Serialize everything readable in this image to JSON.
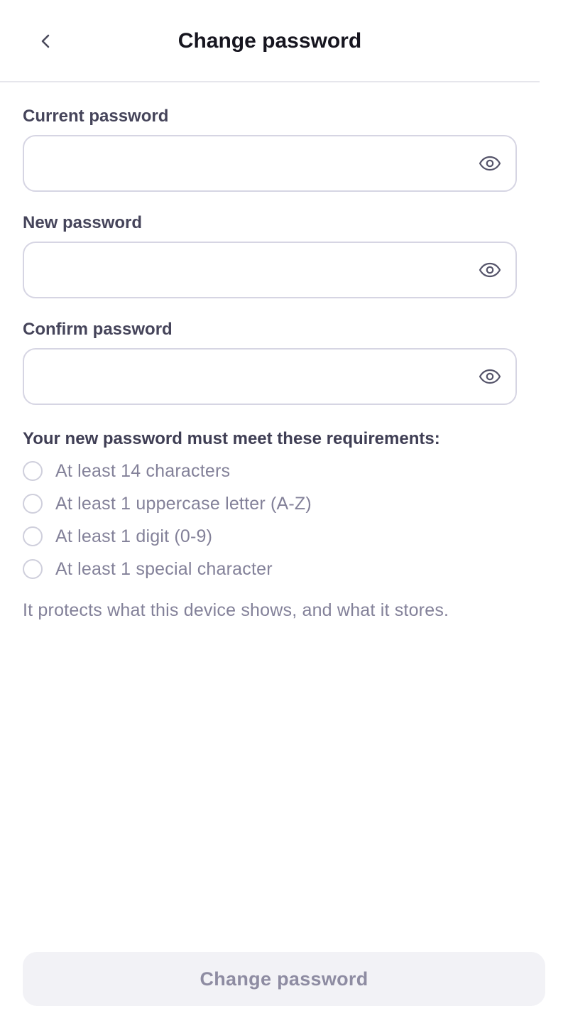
{
  "header": {
    "title": "Change password",
    "back_icon": "chevron-left-icon"
  },
  "fields": {
    "current": {
      "label": "Current password",
      "value": "",
      "icon": "eye-icon"
    },
    "new": {
      "label": "New password",
      "value": "",
      "icon": "eye-icon"
    },
    "confirm": {
      "label": "Confirm password",
      "value": "",
      "icon": "eye-icon"
    }
  },
  "requirements": {
    "heading": "Your new password must meet these requirements:",
    "items": [
      {
        "label": "At least 14 characters",
        "met": false
      },
      {
        "label": "At least 1 uppercase letter (A-Z)",
        "met": false
      },
      {
        "label": "At least 1 digit (0-9)",
        "met": false
      },
      {
        "label": "At least 1 special character",
        "met": false
      }
    ]
  },
  "note": "It protects what this device shows, and what it stores.",
  "submit": {
    "label": "Change password",
    "enabled": false
  },
  "colors": {
    "title": "#16151f",
    "label": "#45445a",
    "muted_text": "#838199",
    "input_border": "#d6d5e3",
    "button_disabled_bg": "#f2f2f6",
    "button_disabled_text": "#8e8ca2"
  }
}
